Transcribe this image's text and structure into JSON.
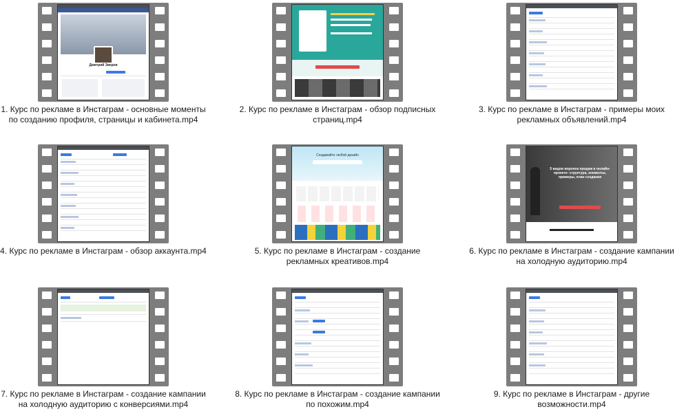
{
  "files": [
    {
      "caption": "1. Курс по рекламе в Инстаграм - основные моменты по созданию профиля, страницы и кабинета.mp4",
      "screen_title": "Дмитрий Зверев"
    },
    {
      "caption": "2. Курс по рекламе в Инстаграм - обзор подписных страниц.mp4",
      "screen_title": ""
    },
    {
      "caption": "3. Курс по рекламе в Инстаграм - примеры моих рекламных объявлений.mp4",
      "screen_title": ""
    },
    {
      "caption": "4. Курс по рекламе в Инстаграм - обзор аккаунта.mp4",
      "screen_title": ""
    },
    {
      "caption": "5. Курс по рекламе в Инстаграм - создание рекламных креативов.mp4",
      "screen_title": "Создавайте любой дизайн"
    },
    {
      "caption": "6. Курс по рекламе в Инстаграм - создание кампании на холодную аудиторию.mp4",
      "screen_title": "5 видов воронок продаж в онлайн-проекте: структура, элементы, примеры, план создания"
    },
    {
      "caption": "7. Курс по рекламе в Инстаграм - создание кампании на холодную аудиторию с конверсиями.mp4",
      "screen_title": ""
    },
    {
      "caption": "8. Курс по рекламе в Инстаграм - создание кампании по похожим.mp4",
      "screen_title": ""
    },
    {
      "caption": "9. Курс по рекламе в Инстаграм - другие возможности.mp4",
      "screen_title": ""
    }
  ],
  "colors": {
    "film": "#7d7d7d",
    "fb_blue": "#3b5998",
    "accent_red": "#e14b4b"
  }
}
